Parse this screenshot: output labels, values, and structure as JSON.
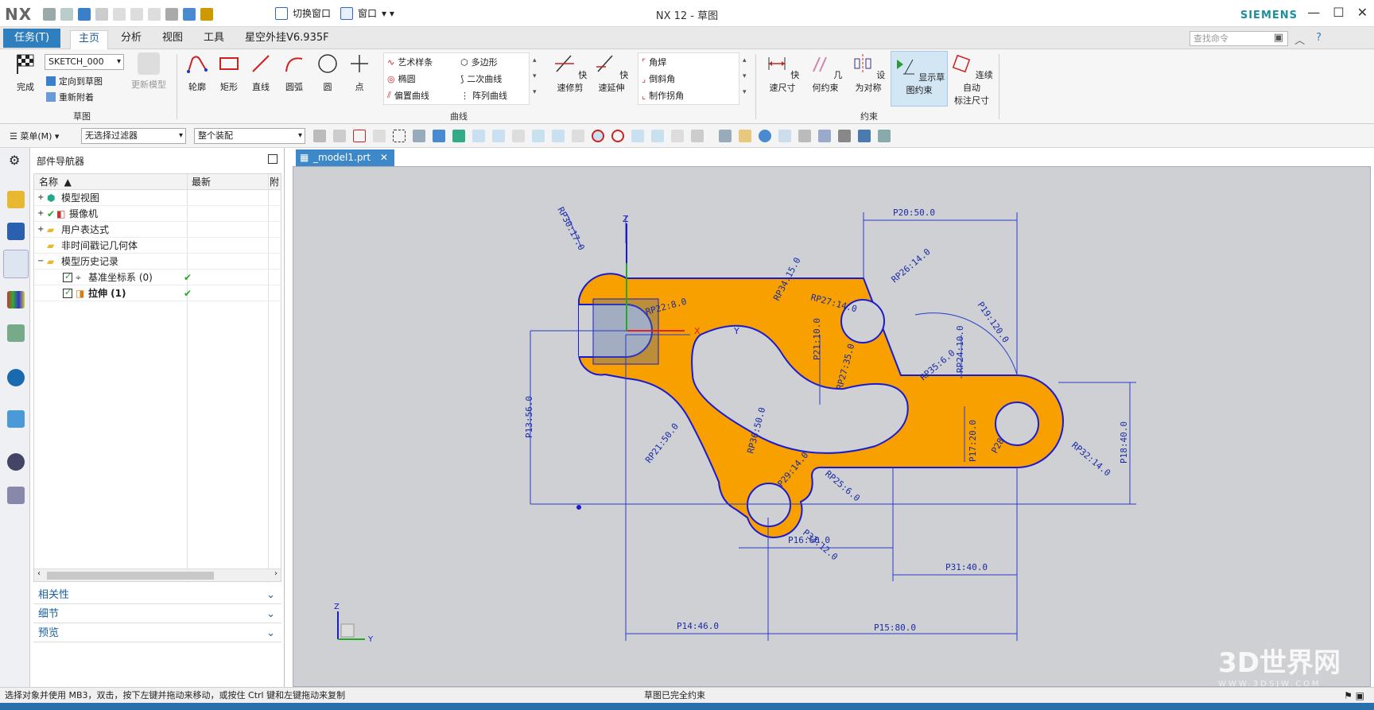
{
  "app": {
    "logo": "NX",
    "title": "NX 12 - 草图",
    "brand": "SIEMENS",
    "min": "—",
    "max": "☐",
    "close": "✕"
  },
  "quick_access": {
    "switch_window": "切换窗口",
    "window_menu": "窗口"
  },
  "tabs": {
    "task": "任务(T)",
    "items": [
      "主页",
      "分析",
      "视图",
      "工具",
      "星空外挂V6.935F"
    ],
    "active": "主页"
  },
  "search": {
    "placeholder": "查找命令"
  },
  "ribbon": {
    "sketch_group": {
      "finish": "完成",
      "sketch_name": "SKETCH_000",
      "orient": "定向到草图",
      "reattach": "重新附着",
      "update_model": "更新模型",
      "label": "草图"
    },
    "curve_group": {
      "profile": "轮廓",
      "rectangle": "矩形",
      "line": "直线",
      "arc": "圆弧",
      "circle": "圆",
      "point": "点",
      "studio_spline": "艺术样条",
      "polygon": "多边形",
      "ellipse": "椭圆",
      "conic": "二次曲线",
      "offset_curve": "偏置曲线",
      "pattern_curve": "阵列曲线",
      "quick_trim": "快速修剪",
      "quick_extend": "快速延伸",
      "fillet": "角焊",
      "chamfer": "倒斜角",
      "make_corner": "制作拐角",
      "label": "曲线"
    },
    "constraint_group": {
      "rapid_dim": "快速尺寸",
      "geom_constraint": "几何约束",
      "make_symmetric": "设为对称",
      "show_constraints": "显示草图约束",
      "auto_dim_1": "连续自动",
      "auto_dim_2": "标注尺寸",
      "label": "约束"
    }
  },
  "toolbar2": {
    "menu": "菜单(M)",
    "filter": "无选择过滤器",
    "scope": "整个装配"
  },
  "navigator": {
    "title": "部件导航器",
    "columns": [
      "名称",
      "最新",
      "附"
    ],
    "rows": [
      {
        "label": "模型视图",
        "check": ""
      },
      {
        "label": "摄像机",
        "check": ""
      },
      {
        "label": "用户表达式",
        "check": ""
      },
      {
        "label": "非时间戳记几何体",
        "check": ""
      },
      {
        "label": "模型历史记录",
        "check": ""
      },
      {
        "label": "基准坐标系 (0)",
        "check": "✔"
      },
      {
        "label": "拉伸 (1)",
        "check": "✔"
      }
    ],
    "panels": [
      "相关性",
      "细节",
      "预览"
    ]
  },
  "doc_tab": {
    "label": "_model1.prt"
  },
  "sketch": {
    "axis_z": "Z",
    "axis_x": "X",
    "axis_y": "Y",
    "triad_z": "Z",
    "triad_y": "Y",
    "dims": [
      "RP30:17.0",
      "RP22:8.0",
      "RP34:15.0",
      "RP26:14.0",
      "RP27:14.0",
      "P20:50.0",
      "P19:120.0",
      "RP24:10.0",
      "P21:10.0",
      "RP27:35.0",
      "RP35:6.0",
      "P13:56.0",
      "RP21:50.0",
      "RP36:50.0",
      "P17:20.0",
      "P28",
      "RP32:14.0",
      "P18:40.0",
      "P29:14.0",
      "RP25:6.0",
      "P16:60.0",
      "P33:12.0",
      "P31:40.0",
      "P14:46.0",
      "P15:80.0"
    ]
  },
  "status": {
    "hint": "选择对象并使用 MB3，双击，按下左键并拖动来移动，或按住 Ctrl 键和左键拖动来复制",
    "state": "草图已完全约束"
  },
  "watermark": {
    "text": "3D世界网",
    "sub": "WWW.3DSJW.COM"
  },
  "colors": {
    "accent": "#2f7fbf",
    "sketch_fill": "#f7a000",
    "sketch_line": "#1a1ad0",
    "canvas": "#cfd0d3"
  }
}
